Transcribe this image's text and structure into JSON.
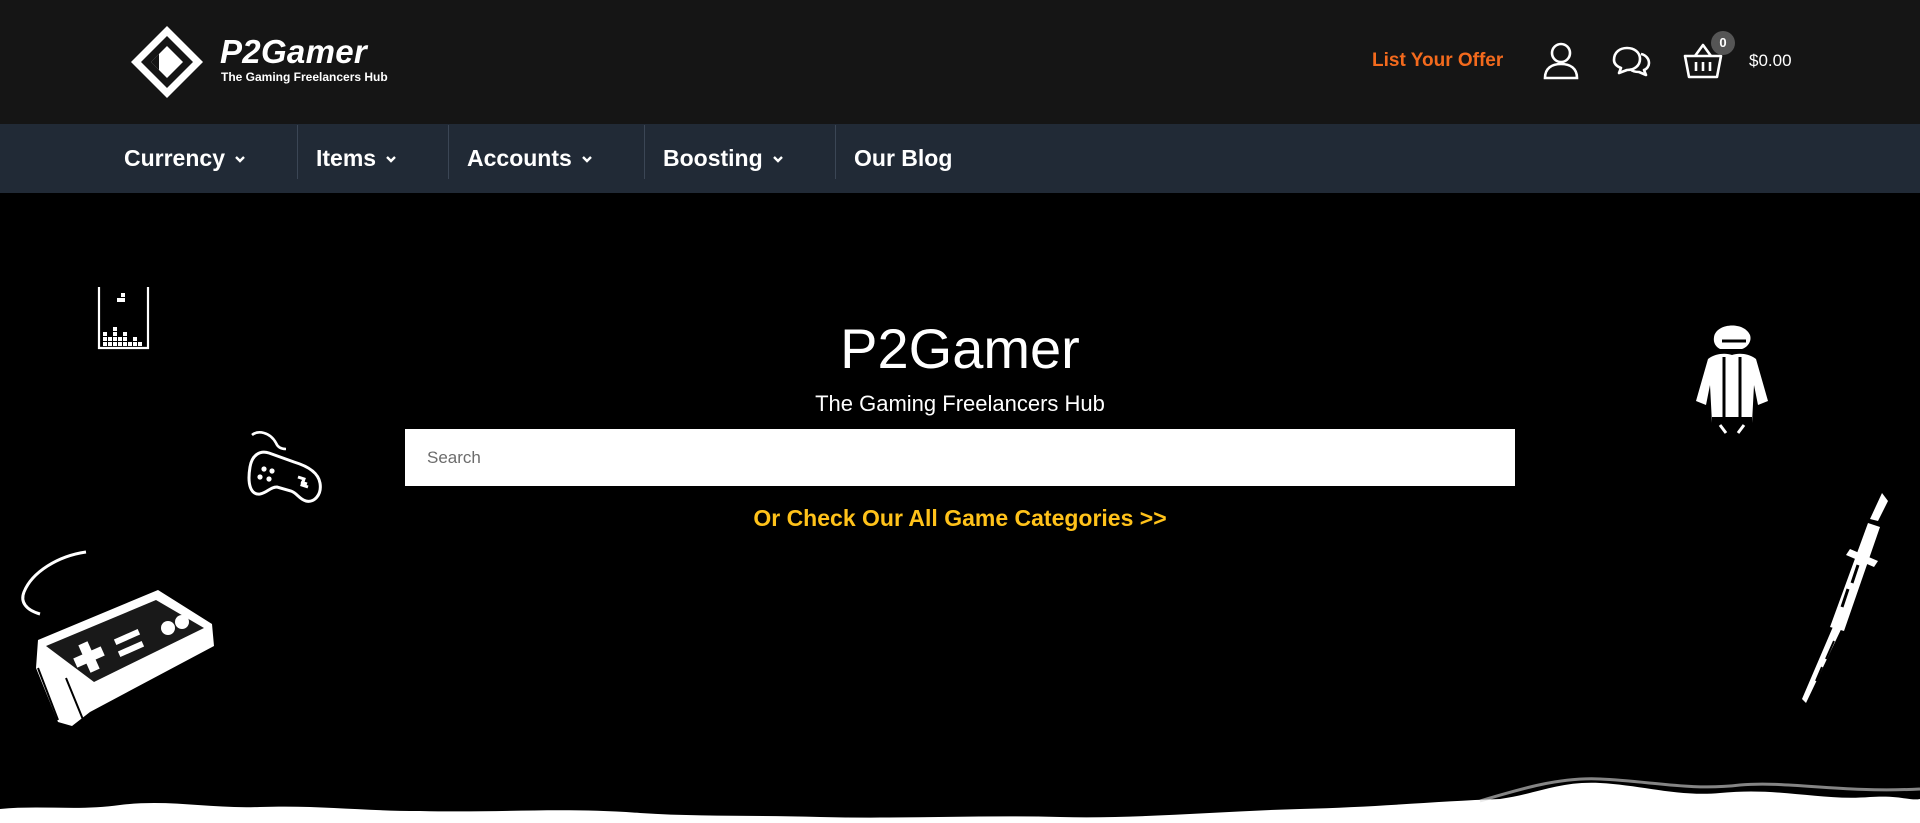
{
  "brand": {
    "name": "P2Gamer",
    "tagline": "The Gaming Freelancers Hub"
  },
  "header": {
    "list_offer_label": "List Your Offer",
    "user_icon": "user-icon",
    "chat_icon": "chat-bubbles-icon",
    "cart_icon": "basket-icon",
    "cart_count": "0",
    "cart_total": "$0.00",
    "accent_color": "#f36a1d"
  },
  "nav": {
    "items": [
      {
        "label": "Currency",
        "has_dropdown": true
      },
      {
        "label": "Items",
        "has_dropdown": true
      },
      {
        "label": "Accounts",
        "has_dropdown": true
      },
      {
        "label": "Boosting",
        "has_dropdown": true
      },
      {
        "label": "Our Blog",
        "has_dropdown": false
      }
    ]
  },
  "hero": {
    "title": "P2Gamer",
    "subtitle": "The Gaming Freelancers Hub",
    "search_placeholder": "Search",
    "categories_link": "Or Check Our All Game Categories >>",
    "link_color": "#ffc21a",
    "decorations": [
      "tetris-icon",
      "gamepad-icon",
      "retro-controller-icon",
      "soldier-icon",
      "sword-icon"
    ]
  }
}
